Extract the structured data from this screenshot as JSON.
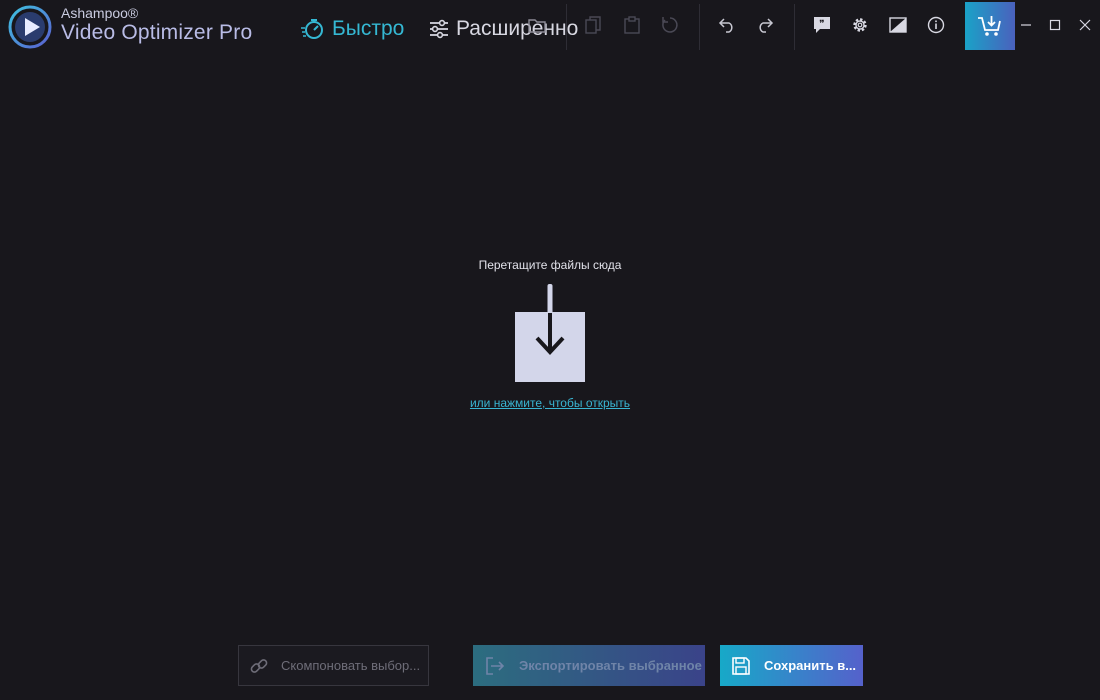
{
  "app": {
    "brand_small": "Ashampoo®",
    "brand_title": "Video Optimizer Pro"
  },
  "modes": {
    "fast_label": "Быстро",
    "advanced_label": "Расширенно",
    "active": "fast"
  },
  "toolbar": {
    "icons": [
      "open-folder-icon",
      "copy-icon",
      "paste-icon",
      "reset-icon",
      "undo-icon",
      "redo-icon",
      "feedback-icon",
      "gear-icon",
      "compare-icon",
      "info-icon",
      "cart-icon"
    ],
    "disabled": [
      "copy-icon",
      "paste-icon",
      "reset-icon"
    ]
  },
  "drop_zone": {
    "title": "Перетащите файлы сюда",
    "link": "или нажмите, чтобы открыть"
  },
  "bottom": {
    "combine_label": "Скомпоновать выбор...",
    "export_label": "Экспортировать выбранное",
    "save_label": "Сохранить в..."
  },
  "colors": {
    "background": "#18171c",
    "accent": "#35b8d3",
    "accent_gradient_end": "#5561cb",
    "drop_box": "#d3d6ea"
  }
}
